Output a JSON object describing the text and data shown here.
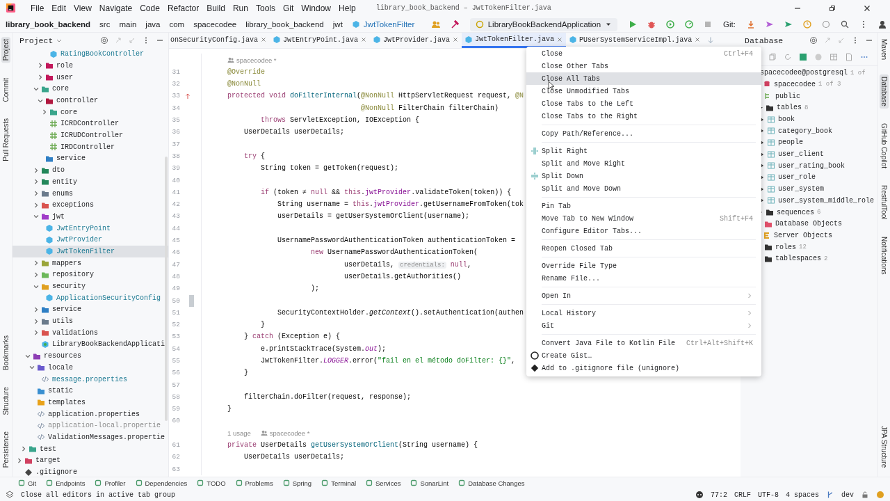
{
  "menu_bar": {
    "items": [
      "File",
      "Edit",
      "View",
      "Navigate",
      "Code",
      "Refactor",
      "Build",
      "Run",
      "Tools",
      "Git",
      "Window",
      "Help"
    ],
    "title": "library_book_backend – JwtTokenFilter.java"
  },
  "nav_bar": {
    "breadcrumbs": [
      "library_book_backend",
      "src",
      "main",
      "java",
      "com",
      "spacecodee",
      "library_book_backend",
      "jwt",
      "JwtTokenFilter"
    ],
    "run_config": "LibraryBookBackendApplication",
    "git_label": "Git:"
  },
  "left_strip": {
    "top": [
      {
        "label": "Project",
        "selected": true
      },
      {
        "label": "Commit",
        "selected": false
      },
      {
        "label": "Pull Requests",
        "selected": false
      }
    ],
    "bottom": [
      {
        "label": "Bookmarks",
        "selected": false
      },
      {
        "label": "Structure",
        "selected": false
      },
      {
        "label": "Persistence",
        "selected": false
      }
    ]
  },
  "right_strip": {
    "top": [
      {
        "label": "Maven",
        "selected": false
      },
      {
        "label": "Database",
        "selected": true
      },
      {
        "label": "GitHub Copilot",
        "selected": false
      },
      {
        "label": "RestfulTool",
        "selected": false
      },
      {
        "label": "Notifications",
        "selected": false
      }
    ],
    "bottom": [
      {
        "label": "JPA Structure",
        "selected": false
      }
    ]
  },
  "project_panel": {
    "title": "Project",
    "tree": [
      {
        "children": [
          {
            "children": [
              {
                "children": [
                  {
                    "children": [
                      {
                        "children": [
                          {
                            "children": [
                              {
                                "label": "RatingBookController",
                                "kind": "class",
                                "modified": true,
                                "ignored": false,
                                "selected": false
                              }
                            ]
                          },
                          {
                            "label": "role",
                            "kind": "folder",
                            "color": "#c2185b",
                            "expanded": false,
                            "modified": false,
                            "ignored": false,
                            "selected": false
                          },
                          {
                            "label": "user",
                            "kind": "folder",
                            "color": "#c2185b",
                            "expanded": false,
                            "modified": false,
                            "ignored": false,
                            "selected": false
                          }
                        ]
                      },
                      {
                        "label": "core",
                        "kind": "folder",
                        "color": "#3aa58c",
                        "expanded": true,
                        "modified": false,
                        "ignored": false,
                        "selected": false,
                        "children": [
                          {
                            "label": "controller",
                            "kind": "folder",
                            "color": "#b0173f",
                            "expanded": true,
                            "modified": false,
                            "ignored": false,
                            "selected": false,
                            "children": [
                              {
                                "label": "core",
                                "kind": "folder",
                                "color": "#3aa58c",
                                "expanded": false,
                                "modified": false,
                                "ignored": false,
                                "selected": false
                              },
                              {
                                "label": "ICRDController",
                                "kind": "interface",
                                "modified": false,
                                "ignored": false,
                                "selected": false
                              },
                              {
                                "label": "ICRUDController",
                                "kind": "interface",
                                "modified": false,
                                "ignored": false,
                                "selected": false
                              },
                              {
                                "label": "IRDController",
                                "kind": "interface",
                                "modified": false,
                                "ignored": false,
                                "selected": false
                              }
                            ]
                          },
                          {
                            "label": "service",
                            "kind": "folder",
                            "color": "#2f7fc4",
                            "modified": false,
                            "ignored": false,
                            "selected": false
                          }
                        ]
                      },
                      {
                        "label": "dto",
                        "kind": "folder",
                        "color": "#23875a",
                        "expanded": false,
                        "modified": false,
                        "ignored": false,
                        "selected": false
                      },
                      {
                        "label": "entity",
                        "kind": "folder",
                        "color": "#23875a",
                        "expanded": false,
                        "modified": false,
                        "ignored": false,
                        "selected": false
                      },
                      {
                        "label": "enums",
                        "kind": "folder",
                        "color": "#6b7b8c",
                        "expanded": false,
                        "modified": false,
                        "ignored": false,
                        "selected": false
                      },
                      {
                        "label": "exceptions",
                        "kind": "folder",
                        "color": "#d9534f",
                        "expanded": false,
                        "modified": false,
                        "ignored": false,
                        "selected": false
                      },
                      {
                        "label": "jwt",
                        "kind": "folder",
                        "color": "#a03cc8",
                        "expanded": true,
                        "modified": false,
                        "ignored": false,
                        "selected": false,
                        "children": [
                          {
                            "label": "JwtEntryPoint",
                            "kind": "class",
                            "modified": true,
                            "ignored": false,
                            "selected": false
                          },
                          {
                            "label": "JwtProvider",
                            "kind": "class",
                            "modified": true,
                            "ignored": false,
                            "selected": false
                          },
                          {
                            "label": "JwtTokenFilter",
                            "kind": "class",
                            "modified": true,
                            "ignored": false,
                            "selected": true
                          }
                        ]
                      },
                      {
                        "label": "mappers",
                        "kind": "folder",
                        "color": "#9aa53a",
                        "expanded": false,
                        "modified": false,
                        "ignored": false,
                        "selected": false
                      },
                      {
                        "label": "repository",
                        "kind": "folder",
                        "color": "#6cb85a",
                        "expanded": false,
                        "modified": false,
                        "ignored": false,
                        "selected": false
                      },
                      {
                        "label": "security",
                        "kind": "folder",
                        "color": "#e0a020",
                        "expanded": true,
                        "modified": false,
                        "ignored": false,
                        "selected": false,
                        "children": [
                          {
                            "label": "ApplicationSecurityConfig",
                            "kind": "class",
                            "modified": true,
                            "ignored": false,
                            "selected": false
                          }
                        ]
                      },
                      {
                        "label": "service",
                        "kind": "folder",
                        "color": "#2f7fc4",
                        "expanded": false,
                        "modified": false,
                        "ignored": false,
                        "selected": false
                      },
                      {
                        "label": "utils",
                        "kind": "folder",
                        "color": "#6b7b8c",
                        "expanded": false,
                        "modified": false,
                        "ignored": false,
                        "selected": false
                      },
                      {
                        "label": "validations",
                        "kind": "folder",
                        "color": "#d9534f",
                        "expanded": false,
                        "modified": false,
                        "ignored": false,
                        "selected": false
                      },
                      {
                        "label": "LibraryBookBackendApplicati",
                        "kind": "app",
                        "modified": false,
                        "ignored": false,
                        "selected": false
                      }
                    ]
                  }
                ]
              },
              {
                "label": "resources",
                "kind": "folder",
                "color": "#8e3fb5",
                "expanded": true,
                "modified": false,
                "ignored": false,
                "selected": false,
                "children": [
                  {
                    "label": "locale",
                    "kind": "folder",
                    "color": "#6a5acd",
                    "expanded": true,
                    "modified": false,
                    "ignored": false,
                    "selected": false,
                    "children": [
                      {
                        "label": "message.properties",
                        "kind": "props",
                        "modified": true,
                        "ignored": false,
                        "selected": false
                      }
                    ]
                  },
                  {
                    "label": "static",
                    "kind": "folder",
                    "color": "#3a8fd0",
                    "modified": false,
                    "ignored": false,
                    "selected": false
                  },
                  {
                    "label": "templates",
                    "kind": "folder",
                    "color": "#e8a21a",
                    "modified": false,
                    "ignored": false,
                    "selected": false
                  },
                  {
                    "label": "application.properties",
                    "kind": "props",
                    "modified": false,
                    "ignored": false,
                    "selected": false
                  },
                  {
                    "label": "application-local.propertie",
                    "kind": "props",
                    "modified": false,
                    "ignored": true,
                    "selected": false
                  },
                  {
                    "label": "ValidationMessages.propertie",
                    "kind": "props",
                    "modified": false,
                    "ignored": false,
                    "selected": false
                  }
                ]
              }
            ]
          },
          {
            "label": "test",
            "kind": "folder",
            "color": "#3aa58c",
            "expanded": false,
            "modified": false,
            "ignored": false,
            "selected": false
          }
        ]
      },
      {
        "label": "target",
        "kind": "folder",
        "color": "#d04060",
        "expanded": false,
        "modified": false,
        "ignored": false,
        "selected": false
      },
      {
        "label": ".gitignore",
        "kind": "ignore",
        "modified": false,
        "ignored": false,
        "selected": false
      }
    ]
  },
  "editor": {
    "tabs": [
      {
        "label": "onSecurityConfig.java",
        "selected": false
      },
      {
        "label": "JwtEntryPoint.java",
        "kind": "class",
        "selected": false
      },
      {
        "label": "JwtProvider.java",
        "kind": "class",
        "selected": false
      },
      {
        "label": "JwtTokenFilter.java",
        "kind": "class",
        "selected": true
      },
      {
        "label": "PUserSystemServiceImpl.java",
        "kind": "class",
        "selected": false
      }
    ],
    "lines": [
      {
        "kind": "hint",
        "author": "spacecodee *"
      },
      {
        "kind": "code",
        "num": "31",
        "tokens": [
          {
            "t": "@Override",
            "kind": "ann"
          }
        ]
      },
      {
        "kind": "code",
        "num": "32",
        "tokens": [
          {
            "t": "@NonNull",
            "kind": "ann"
          }
        ]
      },
      {
        "kind": "override",
        "num": "33",
        "tokens": [
          {
            "t": "protected void ",
            "kind": "kw"
          },
          {
            "t": "doFilterInternal",
            "kind": "decl"
          },
          {
            "t": "(",
            "kind": "plain"
          },
          {
            "t": "@NonNull",
            "kind": "ann"
          },
          {
            "t": " HttpServletRequest request, ",
            "kind": "plain"
          },
          {
            "t": "@N",
            "kind": "ann"
          }
        ]
      },
      {
        "kind": "code",
        "num": "34",
        "tokens": [
          {
            "t": "                                @NonNull",
            "kind": "ann"
          },
          {
            "t": " FilterChain filterChain)",
            "kind": "plain"
          }
        ]
      },
      {
        "kind": "code",
        "num": "35",
        "tokens": [
          {
            "t": "        throws",
            "kind": "kw"
          },
          {
            "t": " ServletException, IOException {",
            "kind": "plain"
          }
        ]
      },
      {
        "kind": "code",
        "num": "36",
        "tokens": [
          {
            "t": "    UserDetails userDetails;",
            "kind": "plain"
          }
        ]
      },
      {
        "kind": "code",
        "num": "37"
      },
      {
        "kind": "code",
        "num": "38",
        "tokens": [
          {
            "t": "    try",
            "kind": "kw"
          },
          {
            "t": " {",
            "kind": "plain"
          }
        ]
      },
      {
        "kind": "code",
        "num": "39",
        "tokens": [
          {
            "t": "        String token = getToken(request);",
            "kind": "plain"
          }
        ]
      },
      {
        "kind": "code",
        "num": "40"
      },
      {
        "kind": "code",
        "num": "41",
        "tokens": [
          {
            "t": "        if",
            "kind": "kw"
          },
          {
            "t": " (token ≠ ",
            "kind": "plain"
          },
          {
            "t": "null",
            "kind": "kw"
          },
          {
            "t": " && ",
            "kind": "plain"
          },
          {
            "t": "this",
            "kind": "kw"
          },
          {
            "t": ".",
            "kind": "plain"
          },
          {
            "t": "jwtProvider",
            "kind": "field"
          },
          {
            "t": ".validateToken(token)) {",
            "kind": "plain"
          }
        ]
      },
      {
        "kind": "code",
        "num": "42",
        "tokens": [
          {
            "t": "            String username = ",
            "kind": "plain"
          },
          {
            "t": "this",
            "kind": "kw"
          },
          {
            "t": ".",
            "kind": "plain"
          },
          {
            "t": "jwtProvider",
            "kind": "field"
          },
          {
            "t": ".getUsernameFromToken(tok",
            "kind": "plain"
          }
        ]
      },
      {
        "kind": "code",
        "num": "43",
        "tokens": [
          {
            "t": "            userDetails = getUserSystemOrClient(username);",
            "kind": "plain"
          }
        ]
      },
      {
        "kind": "code",
        "num": "44"
      },
      {
        "kind": "code",
        "num": "45",
        "tokens": [
          {
            "t": "            UsernamePasswordAuthenticationToken authenticationToken =",
            "kind": "plain"
          }
        ]
      },
      {
        "kind": "code",
        "num": "46",
        "tokens": [
          {
            "t": "                    new",
            "kind": "kw"
          },
          {
            "t": " UsernamePasswordAuthenticationToken(",
            "kind": "plain"
          }
        ]
      },
      {
        "kind": "code",
        "num": "47",
        "tokens": [
          {
            "t": "                            userDetails, ",
            "kind": "plain"
          },
          {
            "t": "credentials:",
            "kind": "hint"
          },
          {
            "t": " null",
            "kind": "kw"
          },
          {
            "t": ",",
            "kind": "plain"
          }
        ]
      },
      {
        "kind": "code",
        "num": "48",
        "tokens": [
          {
            "t": "                            userDetails.getAuthorities()",
            "kind": "plain"
          }
        ]
      },
      {
        "kind": "code",
        "num": "49",
        "tokens": [
          {
            "t": "                    );",
            "kind": "plain"
          }
        ]
      },
      {
        "kind": "changed",
        "num": "50"
      },
      {
        "kind": "code",
        "num": "51",
        "tokens": [
          {
            "t": "            SecurityContextHolder.",
            "kind": "plain"
          },
          {
            "t": "getContext",
            "kind": "italic"
          },
          {
            "t": "().setAuthentication(authen",
            "kind": "plain"
          }
        ]
      },
      {
        "kind": "code",
        "num": "52",
        "tokens": [
          {
            "t": "        }",
            "kind": "plain"
          }
        ]
      },
      {
        "kind": "code",
        "num": "53",
        "tokens": [
          {
            "t": "    } ",
            "kind": "plain"
          },
          {
            "t": "catch",
            "kind": "kw"
          },
          {
            "t": " (Exception e) {",
            "kind": "plain"
          }
        ]
      },
      {
        "kind": "code",
        "num": "54",
        "tokens": [
          {
            "t": "        e.printStackTrace(System.",
            "kind": "plain"
          },
          {
            "t": "out",
            "kind": "static"
          },
          {
            "t": ");",
            "kind": "plain"
          }
        ]
      },
      {
        "kind": "code",
        "num": "55",
        "tokens": [
          {
            "t": "        JwtTokenFilter.",
            "kind": "plain"
          },
          {
            "t": "LOGGER",
            "kind": "static"
          },
          {
            "t": ".error(",
            "kind": "plain"
          },
          {
            "t": "\"fail en el método doFilter: {}\"",
            "kind": "str"
          },
          {
            "t": ",",
            "kind": "plain"
          }
        ]
      },
      {
        "kind": "code",
        "num": "56",
        "tokens": [
          {
            "t": "    }",
            "kind": "plain"
          }
        ]
      },
      {
        "kind": "code",
        "num": "57"
      },
      {
        "kind": "code",
        "num": "58",
        "tokens": [
          {
            "t": "    filterChain.doFilter(request, response);",
            "kind": "plain"
          }
        ]
      },
      {
        "kind": "code",
        "num": "59",
        "tokens": [
          {
            "t": "}",
            "kind": "plain"
          }
        ]
      },
      {
        "kind": "code",
        "num": "60"
      },
      {
        "kind": "hint",
        "usages": "1 usage",
        "author": "spacecodee *"
      },
      {
        "kind": "code",
        "num": "61",
        "tokens": [
          {
            "t": "private",
            "kind": "kw"
          },
          {
            "t": " UserDetails ",
            "kind": "plain"
          },
          {
            "t": "getUserSystemOrClient",
            "kind": "decl"
          },
          {
            "t": "(String username) {",
            "kind": "plain"
          }
        ]
      },
      {
        "kind": "code",
        "num": "62",
        "tokens": [
          {
            "t": "    UserDetails userDetails;",
            "kind": "plain"
          }
        ]
      },
      {
        "kind": "code",
        "num": "63"
      }
    ]
  },
  "context_menu": {
    "groups": [
      [
        {
          "label": "Close",
          "shortcut": "Ctrl+F4",
          "submenu": false,
          "selected": false
        },
        {
          "label": "Close Other Tabs",
          "submenu": false,
          "selected": false
        },
        {
          "label": "Close All Tabs",
          "submenu": false,
          "selected": true
        },
        {
          "label": "Close Unmodified Tabs",
          "submenu": false,
          "selected": false
        },
        {
          "label": "Close Tabs to the Left",
          "submenu": false,
          "selected": false
        },
        {
          "label": "Close Tabs to the Right",
          "submenu": false,
          "selected": false
        }
      ],
      [
        {
          "label": "Copy Path/Reference...",
          "submenu": false,
          "selected": false
        }
      ],
      [
        {
          "label": "Split Right",
          "kind": "split-right",
          "submenu": false,
          "selected": false
        },
        {
          "label": "Split and Move Right",
          "submenu": false,
          "selected": false
        },
        {
          "label": "Split Down",
          "kind": "split-down",
          "submenu": false,
          "selected": false
        },
        {
          "label": "Split and Move Down",
          "submenu": false,
          "selected": false
        }
      ],
      [
        {
          "label": "Pin Tab",
          "submenu": false,
          "selected": false
        },
        {
          "label": "Move Tab to New Window",
          "shortcut": "Shift+F4",
          "submenu": false,
          "selected": false
        },
        {
          "label": "Configure Editor Tabs...",
          "submenu": false,
          "selected": false
        }
      ],
      [
        {
          "label": "Reopen Closed Tab",
          "submenu": false,
          "selected": false
        }
      ],
      [
        {
          "label": "Override File Type",
          "submenu": false,
          "selected": false
        },
        {
          "label": "Rename File...",
          "submenu": false,
          "selected": false
        }
      ],
      [
        {
          "label": "Open In",
          "submenu": true,
          "selected": false
        }
      ],
      [
        {
          "label": "Local History",
          "submenu": true,
          "selected": false
        },
        {
          "label": "Git",
          "submenu": true,
          "selected": false
        }
      ],
      [
        {
          "label": "Convert Java File to Kotlin File",
          "shortcut": "Ctrl+Alt+Shift+K",
          "submenu": false,
          "selected": false
        },
        {
          "label": "Create Gist…",
          "kind": "github",
          "submenu": false,
          "selected": false
        },
        {
          "label": "Add to .gitignore file (unignore)",
          "kind": "git",
          "submenu": false,
          "selected": false
        }
      ]
    ]
  },
  "database_panel": {
    "title": "Database",
    "tree": [
      {
        "label": "spacecodee@postgresql",
        "count": "1 of",
        "selected": false,
        "children": [
          {
            "label": "spacecodee",
            "kind": "database",
            "count": "1 of 3",
            "selected": false,
            "children": [
              {
                "label": "public",
                "kind": "schema",
                "selected": false,
                "children": [
                  {
                    "label": "tables",
                    "kind": "folder",
                    "count": "8",
                    "expanded": true,
                    "selected": false,
                    "children": [
                      {
                        "label": "book",
                        "kind": "table",
                        "expanded": false,
                        "selected": false
                      },
                      {
                        "label": "category_book",
                        "kind": "table",
                        "expanded": false,
                        "selected": false
                      },
                      {
                        "label": "people",
                        "kind": "table",
                        "expanded": false,
                        "selected": false
                      },
                      {
                        "label": "user_client",
                        "kind": "table",
                        "expanded": false,
                        "selected": false
                      },
                      {
                        "label": "user_rating_book",
                        "kind": "table",
                        "expanded": false,
                        "selected": false
                      },
                      {
                        "label": "user_role",
                        "kind": "table",
                        "expanded": false,
                        "selected": false
                      },
                      {
                        "label": "user_system",
                        "kind": "table",
                        "expanded": false,
                        "selected": false
                      },
                      {
                        "label": "user_system_middle_role",
                        "kind": "table",
                        "expanded": false,
                        "selected": false
                      }
                    ]
                  },
                  {
                    "label": "sequences",
                    "kind": "folder",
                    "count": "6",
                    "expanded": false,
                    "selected": false
                  }
                ]
              },
              {
                "label": "Database Objects",
                "kind": "objects",
                "selected": false
              }
            ]
          },
          {
            "label": "Server Objects",
            "kind": "server",
            "selected": false,
            "children": [
              {
                "label": "roles",
                "kind": "folder",
                "count": "12",
                "selected": false
              },
              {
                "label": "tablespaces",
                "kind": "folder",
                "count": "2",
                "selected": false
              }
            ]
          }
        ]
      }
    ]
  },
  "tool_windows": [
    "Git",
    "Endpoints",
    "Profiler",
    "Dependencies",
    "TODO",
    "Problems",
    "Spring",
    "Terminal",
    "Services",
    "SonarLint",
    "Database Changes"
  ],
  "status_bar": {
    "message": "Close all editors in active tab group",
    "position": "77:2",
    "line_ending": "CRLF",
    "encoding": "UTF-8",
    "indent": "4 spaces",
    "branch": "dev"
  }
}
